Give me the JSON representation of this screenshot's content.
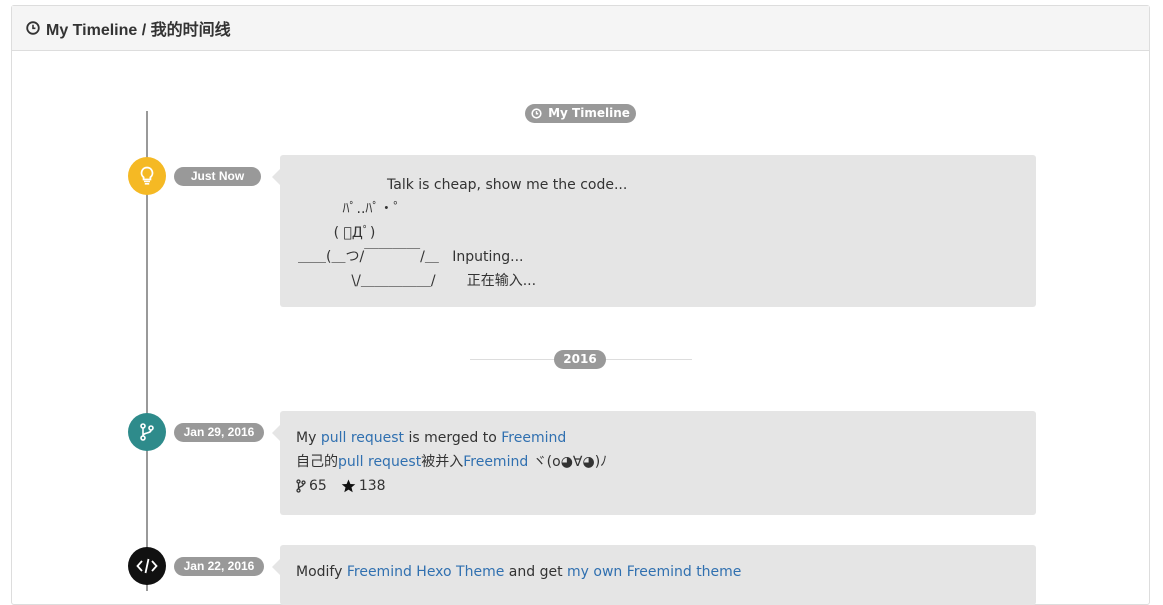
{
  "panel": {
    "title": "My Timeline / 我的时间线"
  },
  "timeline": {
    "header_pill": "My Timeline",
    "year_label": "2016",
    "colors": {
      "yellow": "#f5b924",
      "teal": "#2e8b8b",
      "black": "#111111",
      "link": "#3070b0"
    },
    "entries": [
      {
        "date": "Just Now",
        "icon": "lightbulb-icon",
        "ascii_lines": [
          "                    Talk is cheap, show me the code...",
          "          ﾊﾟ..ﾊﾟ・゜",
          "        ( ﾟДﾟ)",
          "＿＿(＿つ/￣￣￣￣/＿   Inputing...",
          "            \\/＿＿＿＿＿/       正在输入..."
        ]
      },
      {
        "date": "Jan 29, 2016",
        "icon": "git-branch-icon",
        "line1": {
          "prefix": "My ",
          "link1": "pull request",
          "middle": " is merged to ",
          "link2": "Freemind"
        },
        "line2": {
          "prefix": "自己的",
          "link1": "pull request",
          "middle": "被并入",
          "link2": "Freemind",
          "suffix": " ヾ(o◕∀◕)ﾉ"
        },
        "forks": "65",
        "stars": "138"
      },
      {
        "date": "Jan 22, 2016",
        "icon": "code-icon",
        "line1": {
          "prefix": "Modify ",
          "link1": "Freemind Hexo Theme",
          "middle": " and get ",
          "link2": "my own Freemind theme"
        }
      }
    ]
  }
}
